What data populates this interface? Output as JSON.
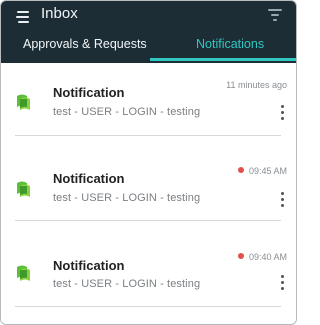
{
  "header": {
    "title": "Inbox",
    "menu_icon": "hamburger-menu-icon",
    "filter_icon": "filter-icon",
    "background": "#1d2d36"
  },
  "tabs": [
    {
      "label": "Approvals & Requests",
      "active": false
    },
    {
      "label": "Notifications",
      "active": true
    }
  ],
  "accent_color": "#2fc7c0",
  "notifications": [
    {
      "title": "Notification",
      "body": "test - USER - LOGIN - testing",
      "time": "11 minutes ago",
      "unread": false
    },
    {
      "title": "Notification",
      "body": "test - USER - LOGIN - testing",
      "time": "09:45 AM",
      "unread": true
    },
    {
      "title": "Notification",
      "body": "test - USER - LOGIN - testing",
      "time": "09:40 AM",
      "unread": true
    }
  ],
  "unread_color": "#e2504d"
}
